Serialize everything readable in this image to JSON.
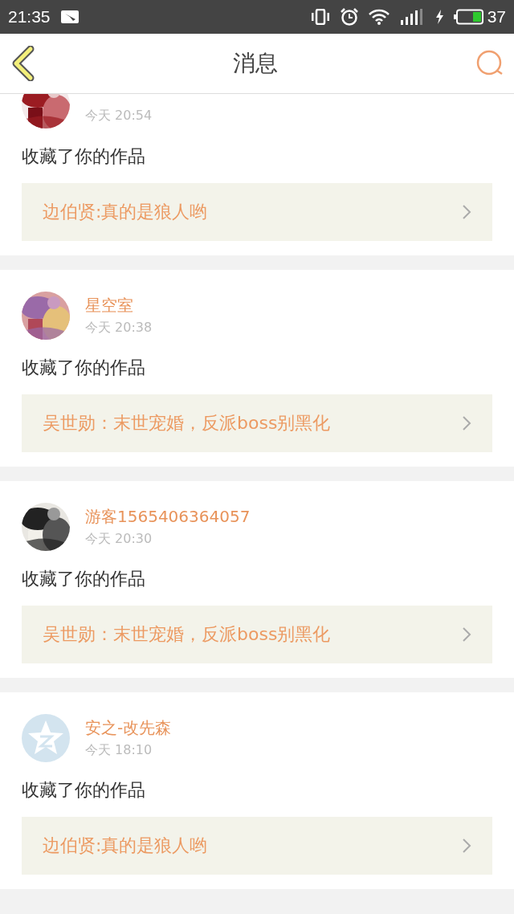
{
  "status_bar": {
    "time": "21:35",
    "battery": "37"
  },
  "header": {
    "title": "消息"
  },
  "messages": [
    {
      "time": "今天 20:54",
      "action": "收藏了你的作品",
      "work": "边伯贤:真的是狼人哟"
    },
    {
      "name": "星空室",
      "time": "今天 20:38",
      "action": "收藏了你的作品",
      "work": "吴世勋：末世宠婚，反派boss别黑化"
    },
    {
      "name": "游客1565406364057",
      "time": "今天 20:30",
      "action": "收藏了你的作品",
      "work": "吴世勋：末世宠婚，反派boss别黑化"
    },
    {
      "avatar": {
        "kind": "default"
      },
      "name": "安之-改先森",
      "time": "今天 18:10",
      "action": "收藏了你的作品",
      "work": "边伯贤:真的是狼人哟"
    }
  ]
}
